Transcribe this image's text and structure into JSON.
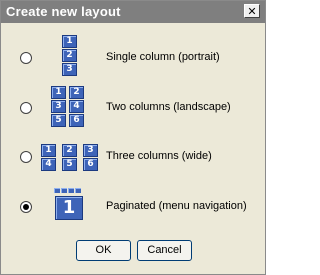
{
  "dialog": {
    "title": "Create new layout",
    "close_icon": "close-icon",
    "options": [
      {
        "label": "Single column (portrait)",
        "selected": false,
        "tiles": [
          "1",
          "2",
          "3"
        ]
      },
      {
        "label": "Two columns (landscape)",
        "selected": false,
        "tiles": [
          "1",
          "2",
          "3",
          "4",
          "5",
          "6"
        ]
      },
      {
        "label": "Three columns (wide)",
        "selected": false,
        "tiles": [
          "1",
          "2",
          "3",
          "4",
          "5",
          "6"
        ]
      },
      {
        "label": "Paginated (menu navigation)",
        "selected": true,
        "tiles": [
          "1"
        ]
      }
    ],
    "ok_label": "OK",
    "cancel_label": "Cancel"
  }
}
